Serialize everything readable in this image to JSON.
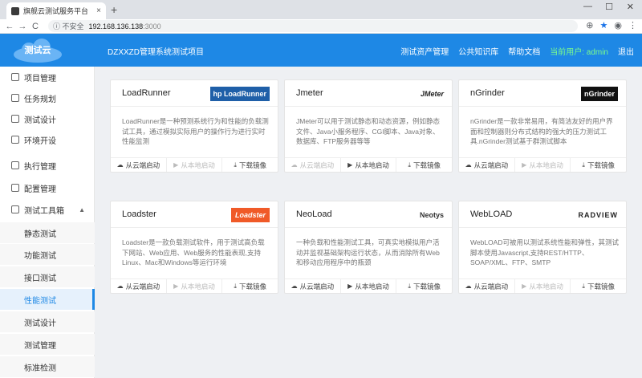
{
  "browser": {
    "tab_title": "旗舰云测试服务平台",
    "tab_close": "×",
    "new_tab": "+",
    "min": "—",
    "max": "☐",
    "close": "✕",
    "back": "←",
    "forward": "→",
    "reload": "C",
    "security": "ⓘ 不安全",
    "url_host": "192.168.136.138",
    "url_port": ":3000",
    "zoom": "⊕",
    "star": "★",
    "profile": "◉",
    "menu": "⋮"
  },
  "header": {
    "logo": "测试云",
    "title": "DZXXZD管理系统测试项目",
    "nav": [
      "测试资产管理",
      "公共知识库",
      "帮助文档"
    ],
    "user": "当前用户: admin",
    "logout": "退出",
    "colors": {
      "bar": "#1e88e5",
      "user": "#7cfc8c"
    }
  },
  "sidebar": {
    "items": [
      {
        "label": "项目管理"
      },
      {
        "label": "任务规划"
      },
      {
        "label": "测试设计"
      },
      {
        "label": "环境开设"
      },
      {
        "label": "执行管理"
      },
      {
        "label": "配置管理"
      },
      {
        "label": "测试工具箱",
        "caret": "▲"
      }
    ],
    "sub_items": [
      {
        "label": "静态测试"
      },
      {
        "label": "功能测试"
      },
      {
        "label": "接口测试"
      },
      {
        "label": "性能测试",
        "active": true
      },
      {
        "label": "测试设计"
      },
      {
        "label": "测试管理"
      },
      {
        "label": "标准检测"
      }
    ]
  },
  "tools": [
    {
      "name": "LoadRunner",
      "brand": "hp LoadRunner",
      "desc": "LoadRunner是一种预测系统行为和性能的负载测试工具，通过模拟实际用户的操作行为进行实时性能监测",
      "actions": [
        {
          "label": "从云端启动",
          "icon": "cloud",
          "enabled": true
        },
        {
          "label": "从本地启动",
          "icon": "play",
          "enabled": false
        },
        {
          "label": "下载镜像",
          "icon": "download",
          "enabled": true
        }
      ]
    },
    {
      "name": "Jmeter",
      "brand": "JMeter",
      "desc": "JMeter可以用于测试静态和动态资源，例如静态文件、Java小服务程序、CGI脚本、Java对象、数据库、FTP服务器等等",
      "actions": [
        {
          "label": "从云端启动",
          "icon": "cloud",
          "enabled": false
        },
        {
          "label": "从本地启动",
          "icon": "play",
          "enabled": true
        },
        {
          "label": "下载镜像",
          "icon": "download",
          "enabled": true
        }
      ]
    },
    {
      "name": "nGrinder",
      "brand": "nGrinder",
      "desc": "nGrinder是一款非常易用，有简洁友好的用户界面和控制器则分布式结构的强大的压力测试工具.nGrinder测试基于群测试脚本",
      "actions": [
        {
          "label": "从云端启动",
          "icon": "cloud",
          "enabled": true
        },
        {
          "label": "从本地启动",
          "icon": "play",
          "enabled": false
        },
        {
          "label": "下载镜像",
          "icon": "download",
          "enabled": true
        }
      ]
    },
    {
      "name": "Loadster",
      "brand": "Loadster",
      "desc": "Loadster是一款负载测试软件，用于测试高负载下网站、Web应用、Web服务的性能表现,支持Linux、Mac和Windows等运行环境",
      "actions": [
        {
          "label": "从云端启动",
          "icon": "cloud",
          "enabled": true
        },
        {
          "label": "从本地启动",
          "icon": "play",
          "enabled": false
        },
        {
          "label": "下载镜像",
          "icon": "download",
          "enabled": true
        }
      ]
    },
    {
      "name": "NeoLoad",
      "brand": "Neotys",
      "desc": "一种负载和性能测试工具，可真实地模拟用户活动并监视基础架构运行状态，从而消除所有Web和移动应用程序中的瓶颈",
      "actions": [
        {
          "label": "从云端启动",
          "icon": "cloud",
          "enabled": true
        },
        {
          "label": "从本地启动",
          "icon": "play",
          "enabled": true
        },
        {
          "label": "下载镜像",
          "icon": "download",
          "enabled": true
        }
      ]
    },
    {
      "name": "WebLOAD",
      "brand": "RADVIEW",
      "desc": "WebLOAD可被用以测试系统性能和弹性，其测试脚本使用Javascript,支持REST/HTTP、SOAP/XML、FTP、SMTP",
      "actions": [
        {
          "label": "从云端启动",
          "icon": "cloud",
          "enabled": true
        },
        {
          "label": "从本地启动",
          "icon": "play",
          "enabled": false
        },
        {
          "label": "下载镜像",
          "icon": "download",
          "enabled": true
        }
      ]
    }
  ]
}
